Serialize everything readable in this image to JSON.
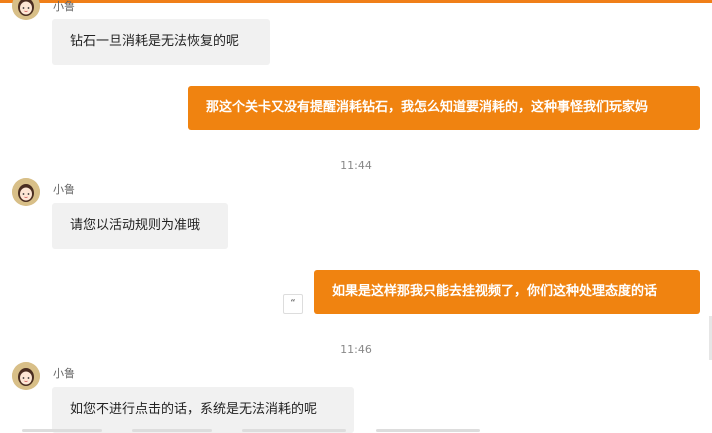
{
  "chat": {
    "messages": [
      {
        "sender": "小鲁",
        "text": "钻石一旦消耗是无法恢复的呢"
      },
      {
        "text": "那这个关卡又没有提醒消耗钻石，我怎么知道要消耗的，这种事怪我们玩家妈"
      },
      {
        "time": "11:44"
      },
      {
        "sender": "小鲁",
        "text": "请您以活动规则为准哦"
      },
      {
        "text": "如果是这样那我只能去挂视频了，你们这种处理态度的话"
      },
      {
        "time": "11:46"
      },
      {
        "sender": "小鲁",
        "text": "如您不进行点击的话，系统是无法消耗的呢"
      }
    ],
    "quote_button": "“"
  },
  "colors": {
    "accent": "#f08310",
    "incoming_bubble": "#f1f1f1"
  }
}
